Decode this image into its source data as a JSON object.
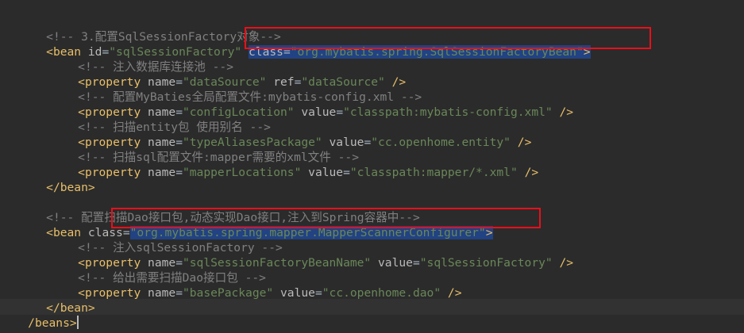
{
  "lines": {
    "l1": "<!-- 3.配置SqlSessionFactory对象-->",
    "l2_open": "<bean",
    "l2_attr_id": "id",
    "l2_val_id": "\"sqlSessionFactory\"",
    "l2_attr_class": "class",
    "l2_val_class": "\"org.mybatis.spring.SqlSessionFactoryBean\"",
    "l2_close": ">",
    "l3": "<!-- 注入数据库连接池 -->",
    "l4_open": "<property",
    "l4_attr1": "name",
    "l4_val1": "\"dataSource\"",
    "l4_attr2": "ref",
    "l4_val2": "\"dataSource\"",
    "l4_close": "/>",
    "l5": "<!-- 配置MyBaties全局配置文件:mybatis-config.xml -->",
    "l6_open": "<property",
    "l6_attr1": "name",
    "l6_val1": "\"configLocation\"",
    "l6_attr2": "value",
    "l6_val2": "\"classpath:mybatis-config.xml\"",
    "l6_close": "/>",
    "l7": "<!-- 扫描entity包 使用别名 -->",
    "l8_open": "<property",
    "l8_attr1": "name",
    "l8_val1": "\"typeAliasesPackage\"",
    "l8_attr2": "value",
    "l8_val2": "\"cc.openhome.entity\"",
    "l8_close": "/>",
    "l9": "<!-- 扫描sql配置文件:mapper需要的xml文件 -->",
    "l10_open": "<property",
    "l10_attr1": "name",
    "l10_val1": "\"mapperLocations\"",
    "l10_attr2": "value",
    "l10_val2": "\"classpath:mapper/*.xml\"",
    "l10_close": "/>",
    "l11": "</bean>",
    "l13": "<!-- 配置扫描Dao接口包,动态实现Dao接口,注入到Spring容器中-->",
    "l14_open": "<bean",
    "l14_attr": "class",
    "l14_val": "\"org.mybatis.spring.mapper.MapperScannerConfigurer\"",
    "l14_close": ">",
    "l15": "<!-- 注入sqlSessionFactory -->",
    "l16_open": "<property",
    "l16_attr1": "name",
    "l16_val1": "\"sqlSessionFactoryBeanName\"",
    "l16_attr2": "value",
    "l16_val2": "\"sqlSessionFactory\"",
    "l16_close": "/>",
    "l17": "<!-- 给出需要扫描Dao接口包 -->",
    "l18_open": "<property",
    "l18_attr1": "name",
    "l18_val1": "\"basePackage\"",
    "l18_attr2": "value",
    "l18_val2": "\"cc.openhome.dao\"",
    "l18_close": "/>",
    "l19": "</bean>",
    "l20": "/beans>"
  },
  "colors": {
    "background": "#2b2b2b",
    "comment": "#808080",
    "tag": "#e8bf6a",
    "attribute": "#bababa",
    "value": "#6a8759",
    "selection": "#214283",
    "highlight_box": "#e8101a"
  }
}
